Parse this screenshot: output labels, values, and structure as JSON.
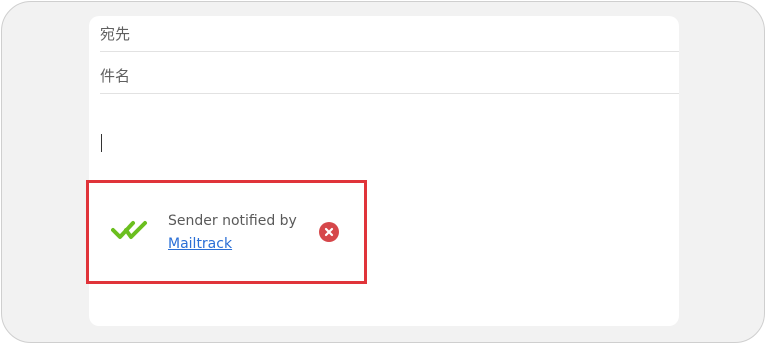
{
  "compose": {
    "to_label": "宛先",
    "subject_label": "件名"
  },
  "mailtrack": {
    "message": "Sender notified by",
    "link_label": "Mailtrack",
    "icons": {
      "check": "double-check-icon",
      "close": "close-icon"
    },
    "colors": {
      "check": "#6bbf1f",
      "link": "#2b6fd6",
      "close": "#d6474a",
      "highlight_border": "#e0343a"
    }
  }
}
